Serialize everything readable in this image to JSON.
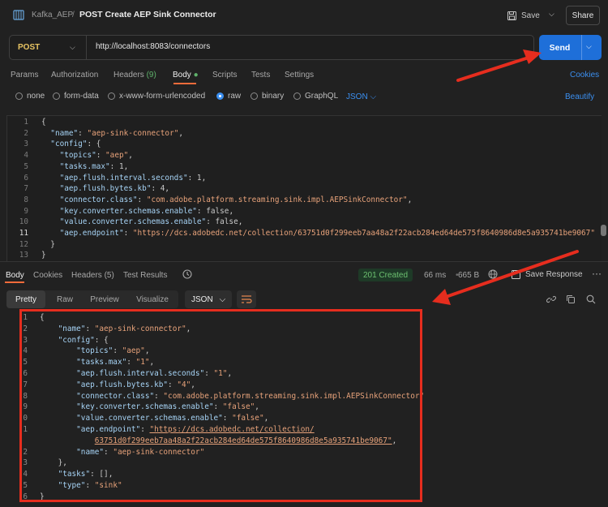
{
  "header": {
    "collection": "Kafka_AEP",
    "separator": "/",
    "title": "POST Create AEP Sink Connector",
    "save_label": "Save",
    "share_label": "Share"
  },
  "request": {
    "method": "POST",
    "url": "http://localhost:8083/connectors",
    "send_label": "Send"
  },
  "request_tabs": {
    "params": "Params",
    "authorization": "Authorization",
    "headers": "Headers",
    "headers_count": "(9)",
    "body": "Body",
    "scripts": "Scripts",
    "tests": "Tests",
    "settings": "Settings",
    "cookies": "Cookies"
  },
  "body_types": {
    "none": "none",
    "form_data": "form-data",
    "urlencoded": "x-www-form-urlencoded",
    "raw": "raw",
    "binary": "binary",
    "graphql": "GraphQL",
    "format": "JSON",
    "beautify": "Beautify"
  },
  "request_body": [
    {
      "n": "1",
      "t": "{"
    },
    {
      "n": "2",
      "k": "\"name\"",
      "v": "\"aep-sink-connector\"",
      "e": ",",
      "i": "  "
    },
    {
      "n": "3",
      "k": "\"config\"",
      "v": "",
      "e": "{",
      "i": "  "
    },
    {
      "n": "4",
      "k": "\"topics\"",
      "v": "\"aep\"",
      "e": ",",
      "i": "    "
    },
    {
      "n": "5",
      "k": "\"tasks.max\"",
      "n2": "1",
      "e": ",",
      "i": "    "
    },
    {
      "n": "6",
      "k": "\"aep.flush.interval.seconds\"",
      "n2": "1",
      "e": ",",
      "i": "    "
    },
    {
      "n": "7",
      "k": "\"aep.flush.bytes.kb\"",
      "n2": "4",
      "e": ",",
      "i": "    "
    },
    {
      "n": "8",
      "k": "\"connector.class\"",
      "v": "\"com.adobe.platform.streaming.sink.impl.AEPSinkConnector\"",
      "e": ",",
      "i": "    "
    },
    {
      "n": "9",
      "k": "\"key.converter.schemas.enable\"",
      "n2": "false",
      "e": ",",
      "i": "    "
    },
    {
      "n": "10",
      "k": "\"value.converter.schemas.enable\"",
      "n2": "false",
      "e": ",",
      "i": "    "
    },
    {
      "n": "11",
      "k": "\"aep.endpoint\"",
      "v": "\"https://dcs.adobedc.net/collection/63751d0f299eeb7aa48a2f22acb284ed64de575f8640986d8e5a935741be9067\"",
      "e": "",
      "i": "    "
    },
    {
      "n": "12",
      "t": "  }"
    },
    {
      "n": "13",
      "t": "}"
    }
  ],
  "response_tabs": {
    "body": "Body",
    "cookies": "Cookies",
    "headers": "Headers",
    "headers_count": "(5)",
    "test_results": "Test Results",
    "status": "201 Created",
    "time": "66 ms",
    "size": "665 B",
    "save_response": "Save Response",
    "more": "···"
  },
  "view_modes": {
    "pretty": "Pretty",
    "raw": "Raw",
    "preview": "Preview",
    "visualize": "Visualize",
    "format": "JSON"
  },
  "response_body": [
    {
      "n": "1",
      "t": "{"
    },
    {
      "n": "2",
      "k": "\"name\"",
      "v": "\"aep-sink-connector\"",
      "e": ",",
      "i": "    "
    },
    {
      "n": "3",
      "k": "\"config\"",
      "v": "",
      "e": "{",
      "i": "    "
    },
    {
      "n": "4",
      "k": "\"topics\"",
      "v": "\"aep\"",
      "e": ",",
      "i": "        "
    },
    {
      "n": "5",
      "k": "\"tasks.max\"",
      "v": "\"1\"",
      "e": ",",
      "i": "        "
    },
    {
      "n": "6",
      "k": "\"aep.flush.interval.seconds\"",
      "v": "\"1\"",
      "e": ",",
      "i": "        "
    },
    {
      "n": "7",
      "k": "\"aep.flush.bytes.kb\"",
      "v": "\"4\"",
      "e": ",",
      "i": "        "
    },
    {
      "n": "8",
      "k": "\"connector.class\"",
      "v": "\"com.adobe.platform.streaming.sink.impl.AEPSinkConnector\"",
      "e": ",",
      "i": "        "
    },
    {
      "n": "9",
      "k": "\"key.converter.schemas.enable\"",
      "v": "\"false\"",
      "e": ",",
      "i": "        "
    },
    {
      "n": "0",
      "k": "\"value.converter.schemas.enable\"",
      "v": "\"false\"",
      "e": ",",
      "i": "        "
    },
    {
      "n": "1",
      "k": "\"aep.endpoint\"",
      "u": "\"https://dcs.adobedc.net/collection/",
      "e": "",
      "i": "        "
    },
    {
      "n": "",
      "u": "63751d0f299eeb7aa48a2f22acb284ed64de575f8640986d8e5a935741be9067\"",
      "e": ",",
      "i": "            "
    },
    {
      "n": "2",
      "k": "\"name\"",
      "v": "\"aep-sink-connector\"",
      "e": "",
      "i": "        "
    },
    {
      "n": "3",
      "t": "    },"
    },
    {
      "n": "4",
      "k": "\"tasks\"",
      "n2": "[]",
      "e": ",",
      "i": "    "
    },
    {
      "n": "5",
      "k": "\"type\"",
      "v": "\"sink\"",
      "e": "",
      "i": "    "
    },
    {
      "n": "6",
      "t": "}"
    }
  ],
  "colors": {
    "accent_send": "#1e6fd9",
    "method": "#e8c463",
    "annotation_red": "#e62d1e",
    "status_ok": "#6cc070"
  }
}
